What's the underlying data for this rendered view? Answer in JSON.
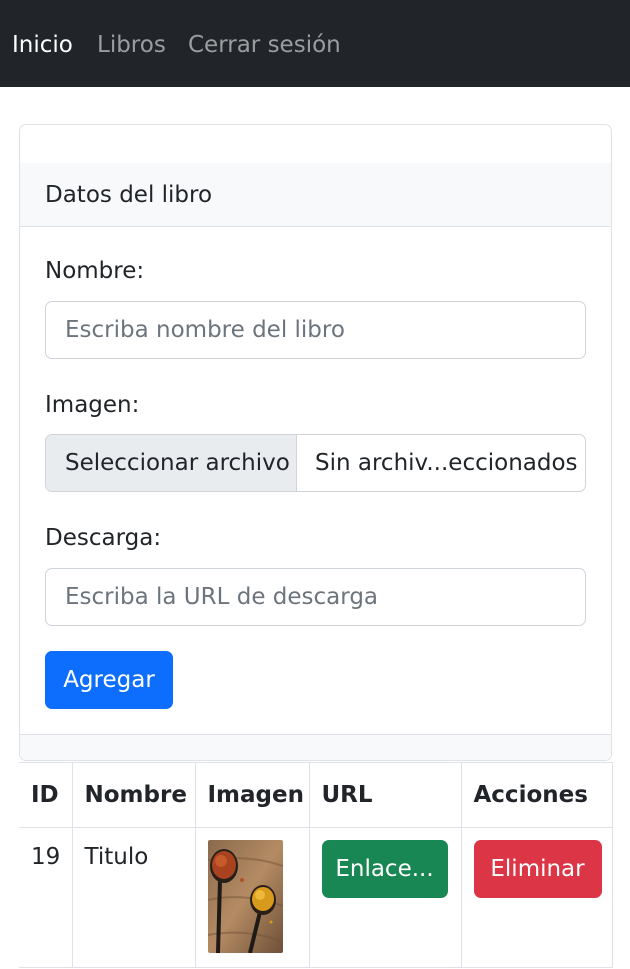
{
  "nav": {
    "items": [
      {
        "label": "Inicio",
        "active": true
      },
      {
        "label": "Libros",
        "active": false
      },
      {
        "label": "Cerrar sesión",
        "active": false
      }
    ]
  },
  "form": {
    "header": "Datos del libro",
    "nombre_label": "Nombre:",
    "nombre_placeholder": "Escriba nombre del libro",
    "imagen_label": "Imagen:",
    "file_button": "Seleccionar archivo",
    "file_status": "Sin archiv...eccionados",
    "descarga_label": "Descarga:",
    "descarga_placeholder": "Escriba la URL de descarga",
    "submit_label": "Agregar"
  },
  "table": {
    "headers": [
      "ID",
      "Nombre",
      "Imagen",
      "URL",
      "Acciones"
    ],
    "rows": [
      {
        "id": "19",
        "nombre": "Titulo",
        "imagen_icon": "spices-photo",
        "url_label": "Enlace...",
        "delete_label": "Eliminar"
      }
    ]
  },
  "colors": {
    "navbar": "#212529",
    "primary": "#0d6efd",
    "success": "#198754",
    "danger": "#dc3545"
  }
}
